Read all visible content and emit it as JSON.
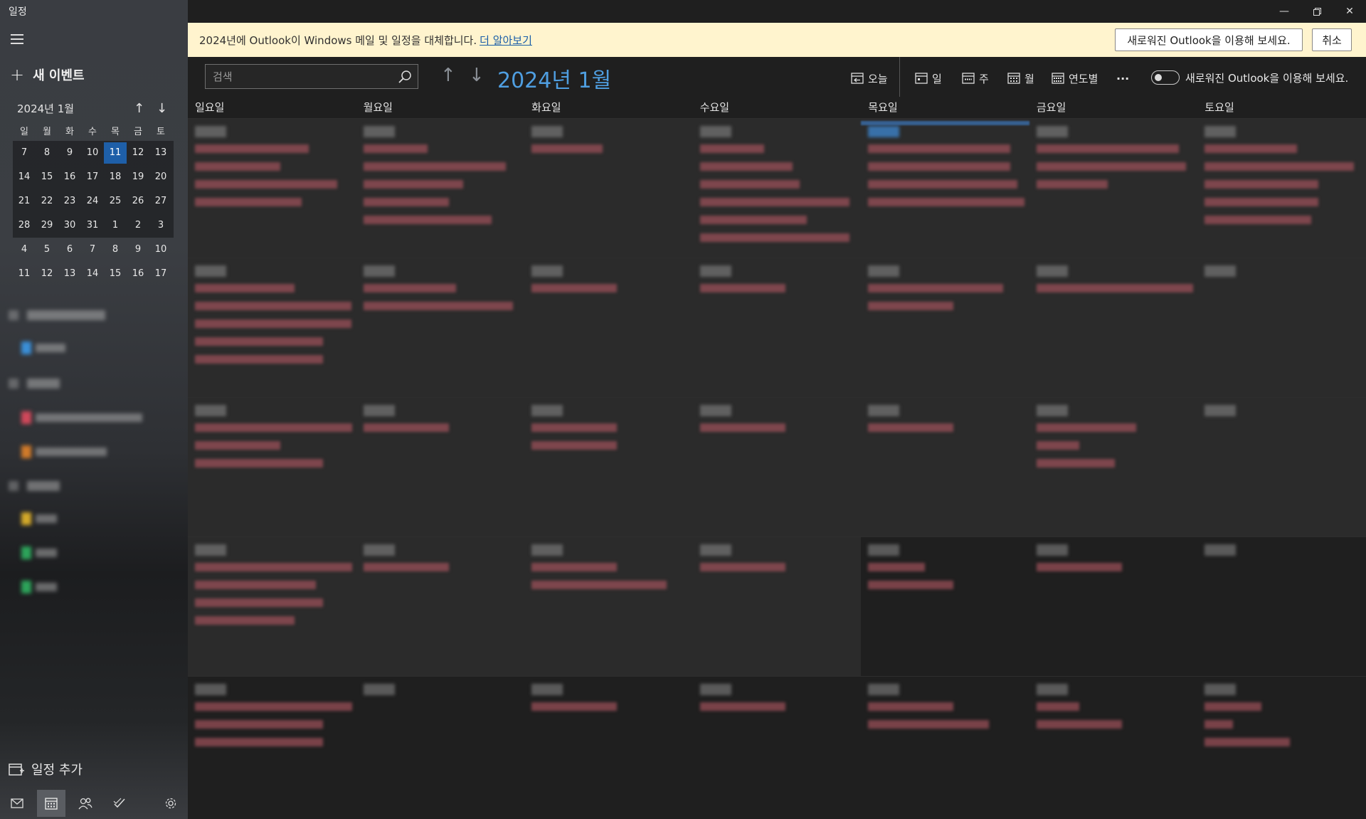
{
  "app": {
    "title": "일정"
  },
  "sidebar": {
    "new_event": "새 이벤트",
    "mini_calendar": {
      "month_label": "2024년 1월",
      "weekdays": [
        "일",
        "월",
        "화",
        "수",
        "목",
        "금",
        "토"
      ],
      "weeks": [
        [
          "7",
          "8",
          "9",
          "10",
          "11",
          "12",
          "13"
        ],
        [
          "14",
          "15",
          "16",
          "17",
          "18",
          "19",
          "20"
        ],
        [
          "21",
          "22",
          "23",
          "24",
          "25",
          "26",
          "27"
        ],
        [
          "28",
          "29",
          "30",
          "31",
          "1",
          "2",
          "3"
        ],
        [
          "4",
          "5",
          "6",
          "7",
          "8",
          "9",
          "10"
        ],
        [
          "11",
          "12",
          "13",
          "14",
          "15",
          "16",
          "17"
        ]
      ],
      "today": "11"
    },
    "calendar_colors": [
      "#3a8fd8",
      "#d0485a",
      "#d07a2a",
      "#d4a92a",
      "#2da35a",
      "#2da35a"
    ],
    "add_calendar": "일정 추가",
    "bottom_nav": {
      "icons": [
        "mail-icon",
        "calendar-icon",
        "people-icon",
        "todo-icon",
        "settings-icon"
      ],
      "active": "calendar-icon"
    }
  },
  "banner": {
    "text": "2024년에 Outlook이 Windows 메일 및 일정을 대체합니다.",
    "link": "더 알아보기",
    "try_button": "새로워진 Outlook을 이용해 보세요.",
    "cancel_button": "취소"
  },
  "toolbar": {
    "search_placeholder": "검색",
    "month_title": "2024년 1월",
    "today_label": "오늘",
    "day_label": "일",
    "week_label": "주",
    "month_label": "월",
    "year_label": "연도별",
    "more_label": "···",
    "toggle_label": "새로워진 Outlook을 이용해 보세요."
  },
  "grid": {
    "weekdays": [
      "일요일",
      "월요일",
      "화요일",
      "수요일",
      "목요일",
      "금요일",
      "토요일"
    ]
  },
  "colors": {
    "accent": "#4f9ee0",
    "today": "#1e5fa8",
    "banner_bg": "#fff4ce"
  }
}
